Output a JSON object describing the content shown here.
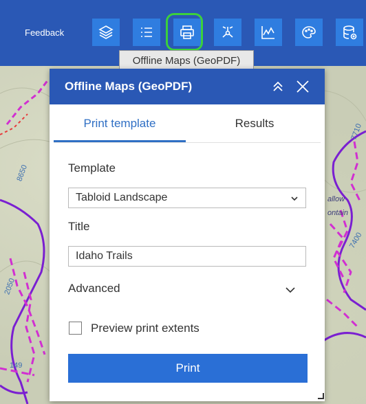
{
  "toolbar": {
    "feedback_label": "Feedback",
    "tools": [
      {
        "icon": "layers-icon"
      },
      {
        "icon": "list-icon"
      },
      {
        "icon": "print-icon",
        "highlighted": true
      },
      {
        "icon": "network-icon"
      },
      {
        "icon": "profile-chart-icon"
      },
      {
        "icon": "palette-icon"
      },
      {
        "icon": "database-icon"
      }
    ],
    "tooltip": "Offline Maps (GeoPDF)"
  },
  "panel": {
    "title": "Offline Maps (GeoPDF)",
    "tabs": [
      {
        "label": "Print template",
        "active": true
      },
      {
        "label": "Results",
        "active": false
      }
    ],
    "template_label": "Template",
    "template_value": "Tabloid Landscape",
    "title_label": "Title",
    "title_value": "Idaho Trails",
    "advanced_label": "Advanced",
    "preview_label": "Preview print extents",
    "preview_checked": false,
    "print_button": "Print"
  },
  "map": {
    "labels": [
      "7710",
      "allow",
      "ontain",
      "7400",
      "2050",
      "149",
      "8650"
    ]
  },
  "colors": {
    "header_blue": "#2a58b5",
    "button_blue": "#2f7de0",
    "highlight_green": "#3cd03c",
    "accent_blue": "#2f6fc4",
    "trail_magenta": "#d12fd1",
    "boundary_purple": "#7a1fd1"
  }
}
